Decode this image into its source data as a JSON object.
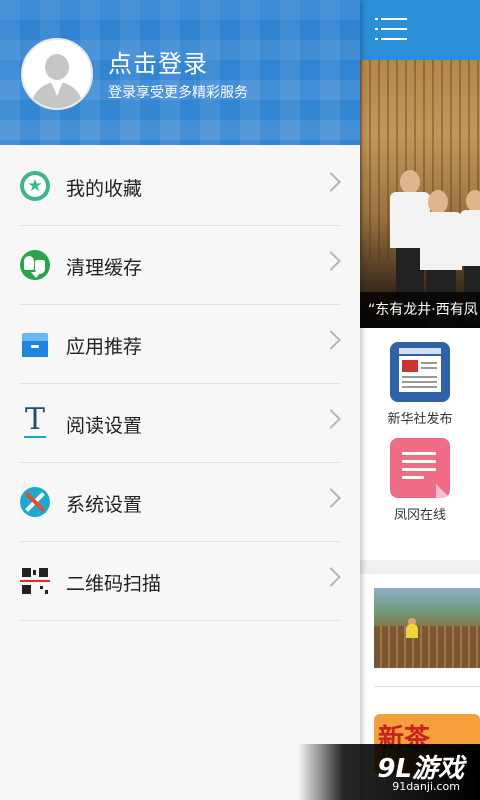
{
  "drawer": {
    "login_title": "点击登录",
    "login_subtitle": "登录享受更多精彩服务",
    "items": [
      {
        "label": "我的收藏",
        "icon": "star-icon"
      },
      {
        "label": "清理缓存",
        "icon": "clean-cache-icon"
      },
      {
        "label": "应用推荐",
        "icon": "app-box-icon"
      },
      {
        "label": "阅读设置",
        "icon": "text-icon"
      },
      {
        "label": "系统设置",
        "icon": "tools-icon"
      },
      {
        "label": "二维码扫描",
        "icon": "qr-scan-icon"
      }
    ]
  },
  "background": {
    "photo_caption": "“东有龙井·西有凤",
    "apps": [
      {
        "label": "新华社发布",
        "icon": "newspaper-icon"
      },
      {
        "label": "凤冈在线",
        "icon": "document-icon"
      }
    ],
    "thumb2_text": "新茶"
  },
  "watermark": {
    "title": "9L游戏",
    "subtitle": "91danji.com"
  },
  "colors": {
    "header_blue": "#3a8fd8",
    "topbar_blue": "#2c90d9",
    "divider": "#e3e3e3"
  }
}
